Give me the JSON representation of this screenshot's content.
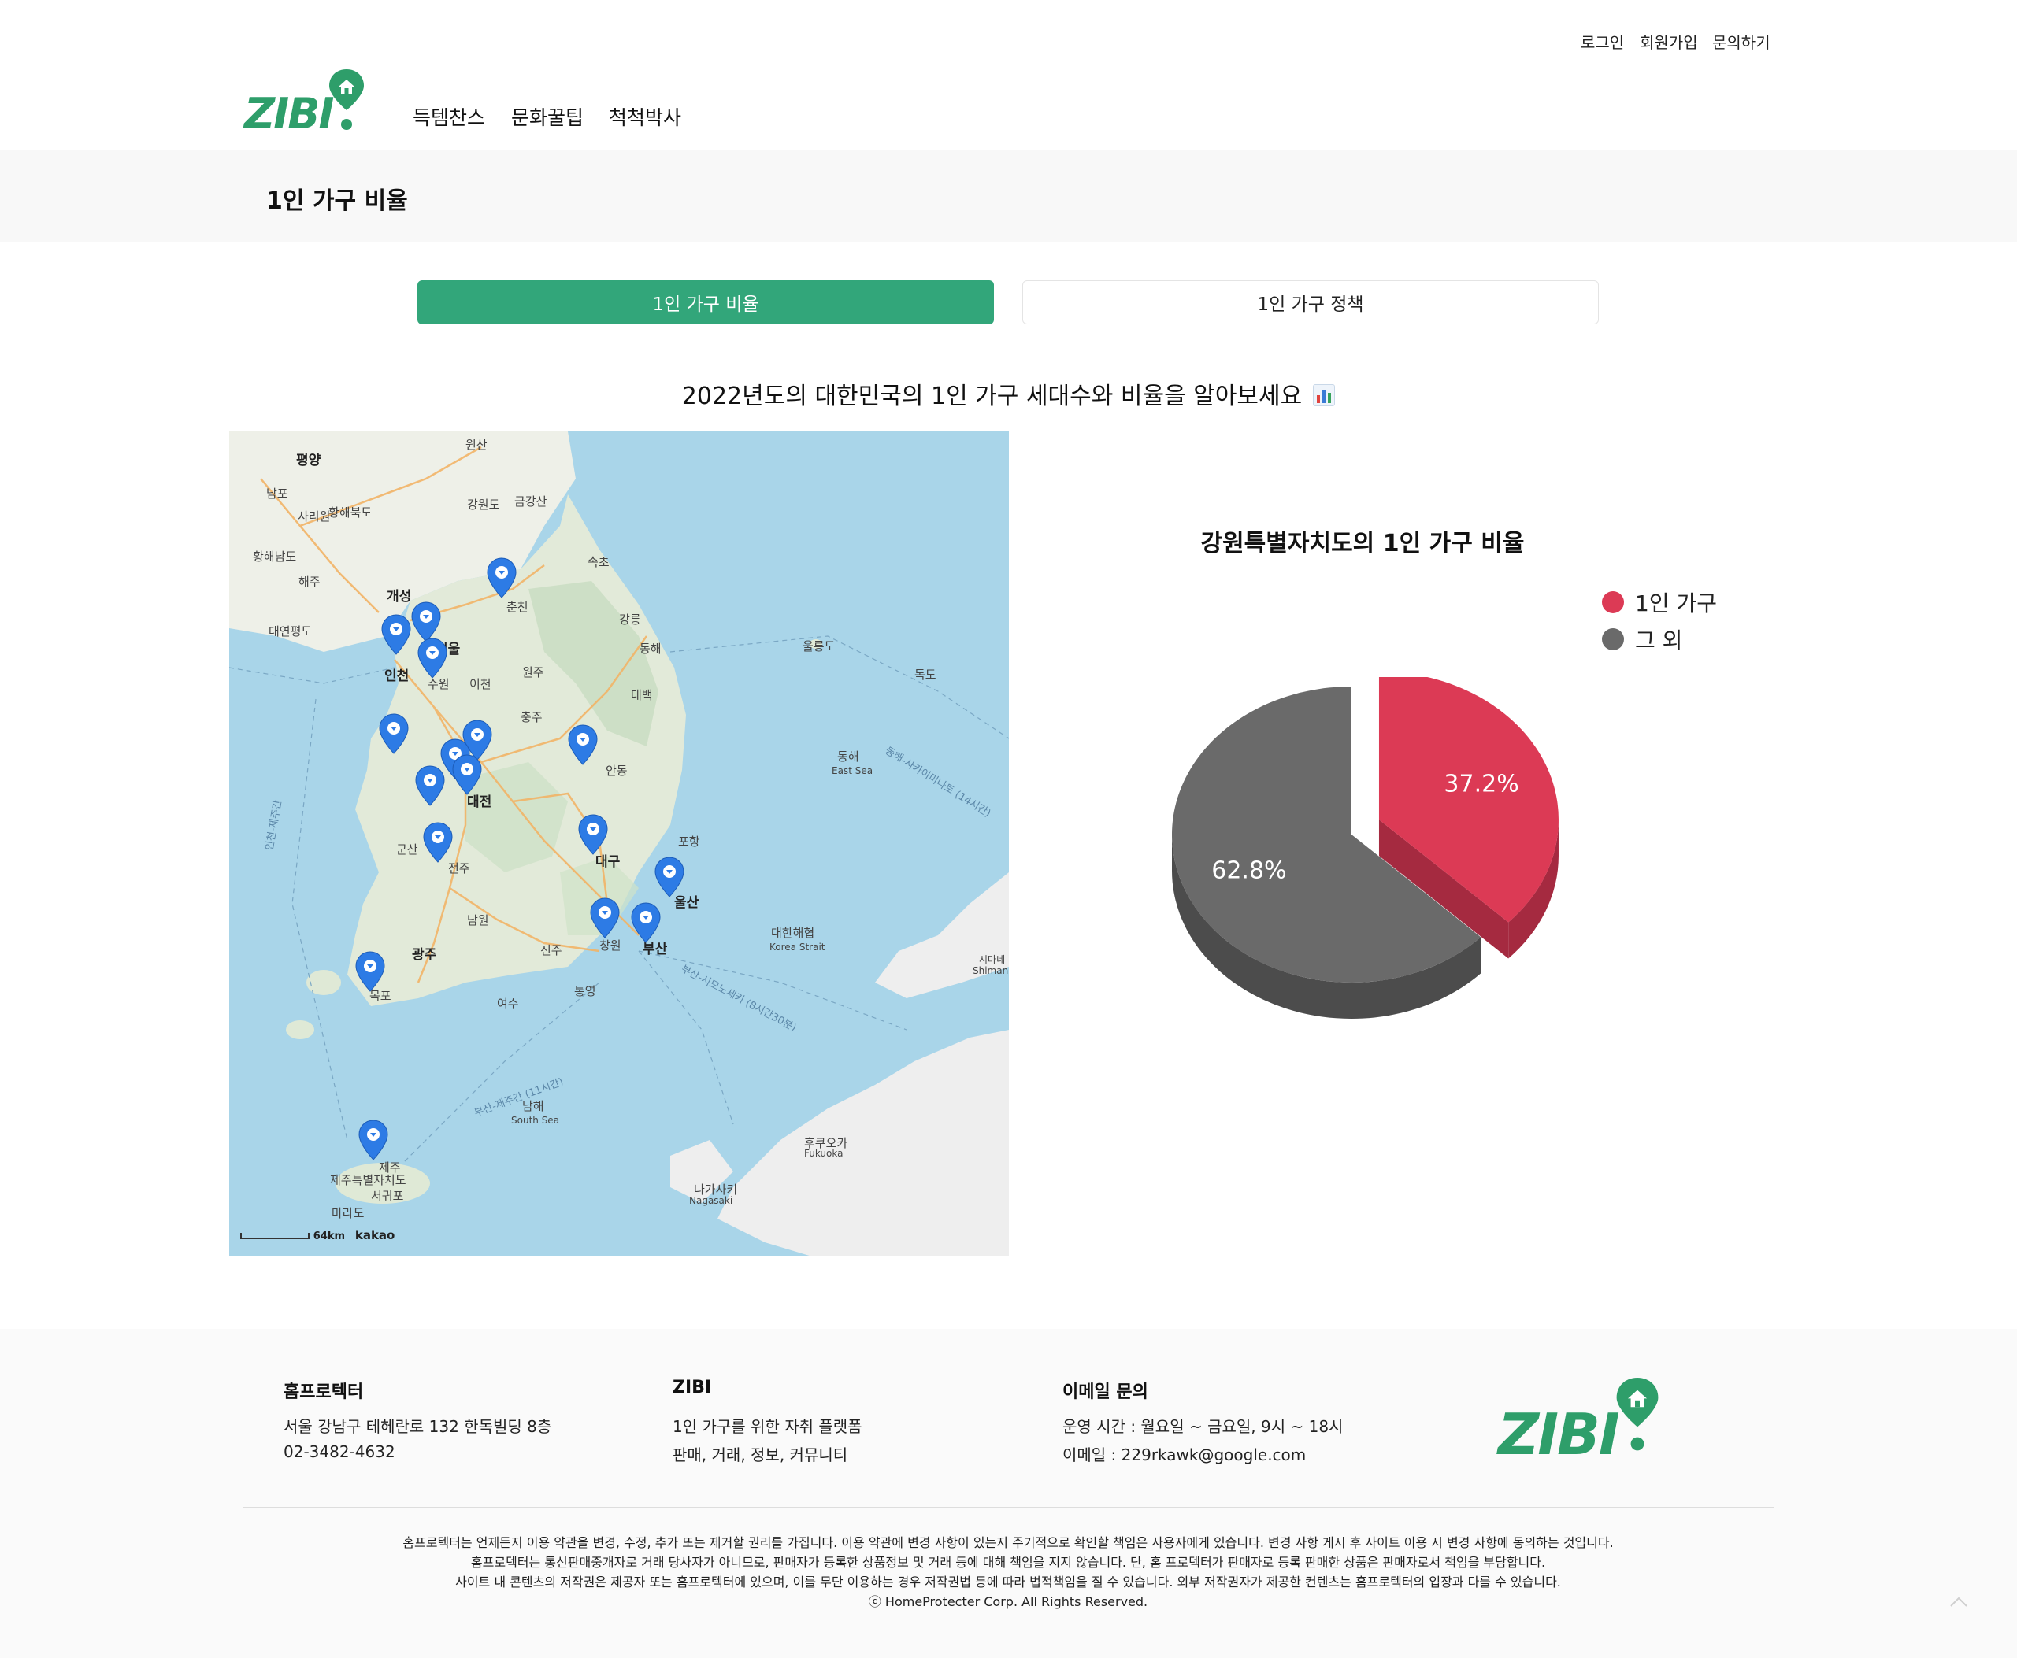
{
  "top_links": [
    "로그인",
    "회원가입",
    "문의하기"
  ],
  "brand": {
    "logo_text": "ZIBI",
    "accent_color": "#2e9e6a"
  },
  "nav": [
    "득템찬스",
    "문화꿀팁",
    "척척박사"
  ],
  "page_title": "1인 가구 비율",
  "tabs": [
    {
      "label": "1인 가구 비율",
      "active": true
    },
    {
      "label": "1인 가구 정책",
      "active": false
    }
  ],
  "intro_text": "2022년도의 대한민국의 1인 가구 세대수와 비율을 알아보세요",
  "map": {
    "labels": [
      "평양",
      "남포",
      "사리원",
      "황해북도",
      "황해남도",
      "해주",
      "개성",
      "대연평도",
      "원산",
      "강원도",
      "금강산",
      "속초",
      "춘천",
      "강릉",
      "동해",
      "울릉도",
      "독도",
      "인천",
      "서울",
      "수원",
      "이천",
      "원주",
      "태백",
      "충주",
      "대전",
      "안동",
      "군산",
      "전주",
      "대구",
      "포항",
      "울산",
      "남원",
      "광주",
      "진주",
      "창원",
      "부산",
      "목포",
      "여수",
      "통영",
      "동해",
      "East Sea",
      "대한해협",
      "Korea Strait",
      "남해",
      "South Sea",
      "제주",
      "제주특별자치도",
      "서귀포",
      "마라도",
      "후쿠오카",
      "Fukuoka",
      "나가사키",
      "Nagasaki",
      "시마네",
      "Shimane",
      "인천-제주간",
      "동해-사카이미나토 (14시간)",
      "부산-시모노세키 (8시간30분)",
      "부산-제주간 (11시간)"
    ],
    "scale_text": "64km",
    "provider": "kakao"
  },
  "chart_data": {
    "type": "pie",
    "title": "강원특별자치도의 1인 가구 비율",
    "categories": [
      "1인 가구",
      "그 외"
    ],
    "values": [
      37.2,
      62.8
    ],
    "value_labels": [
      "37.2%",
      "62.8%"
    ],
    "colors": [
      "#dc3a55",
      "#6a6a6a"
    ],
    "legend_position": "top-right"
  },
  "footer": {
    "col1": {
      "title": "홈프로텍터",
      "lines": [
        "서울 강남구 테헤란로 132 한독빌딩 8층",
        "02-3482-4632"
      ]
    },
    "col2": {
      "title": "ZIBI",
      "lines": [
        "1인 가구를 위한 자취 플랫폼",
        "판매, 거래, 정보, 커뮤니티"
      ]
    },
    "col3": {
      "title": "이메일 문의",
      "lines": [
        "운영 시간 : 월요일 ~ 금요일, 9시 ~ 18시",
        "이메일 : 229rkawk@google.com"
      ]
    },
    "notices": [
      "홈프로텍터는 언제든지 이용 약관을 변경, 수정, 추가 또는 제거할 권리를 가집니다. 이용 약관에 변경 사항이 있는지 주기적으로 확인할 책임은 사용자에게 있습니다. 변경 사항 게시 후 사이트 이용 시 변경 사항에 동의하는 것입니다.",
      "홈프로텍터는 통신판매중개자로 거래 당사자가 아니므로, 판매자가 등록한 상품정보 및 거래 등에 대해 책임을 지지 않습니다. 단, 홈 프로텍터가 판매자로 등록 판매한 상품은 판매자로서 책임을 부담합니다.",
      "사이트 내 콘텐츠의 저작권은 제공자 또는 홈프로텍터에 있으며, 이를 무단 이용하는 경우 저작권법 등에 따라 법적책임을 질 수 있습니다. 외부 저작권자가 제공한 컨텐츠는 홈프로텍터의 입장과 다를 수 있습니다.",
      "ⓒ HomeProtecter Corp. All Rights Reserved."
    ]
  }
}
